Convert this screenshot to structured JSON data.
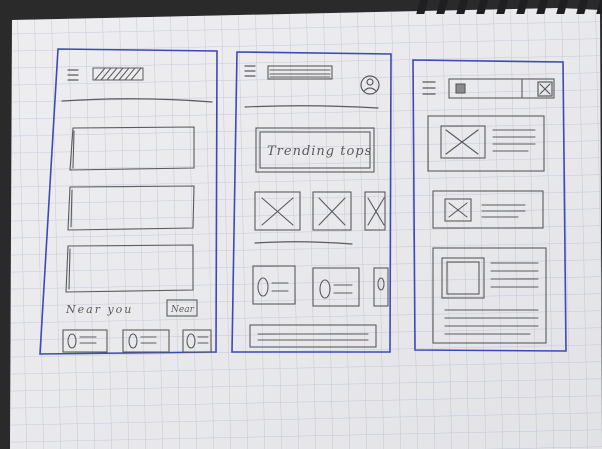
{
  "photo": {
    "subject": "hand-drawn wireframes on grid paper",
    "paper_color": "#ececef",
    "grid_color": "#b9bfd1",
    "pen_color": "#3b49b8",
    "pencil_color": "#5b5b5b",
    "background_color": "#2a2a2a"
  },
  "sketch_1": {
    "handwritten_text": "Near you",
    "button_text": "Near"
  },
  "sketch_2": {
    "handwritten_text": "Trending tops"
  }
}
